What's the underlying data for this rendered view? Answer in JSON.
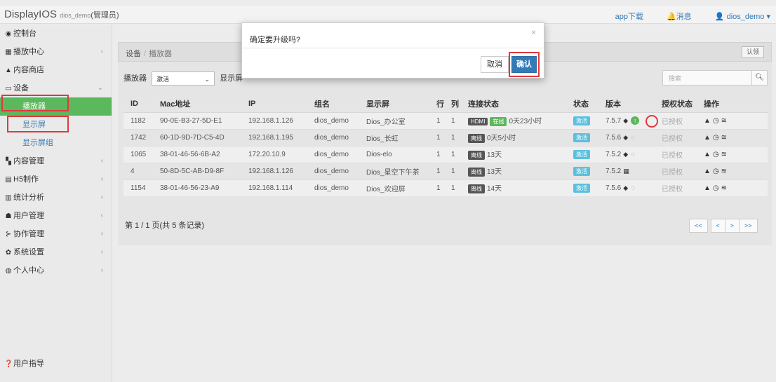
{
  "header": {
    "brand": "DisplayIOS",
    "brand_user": "dios_demo",
    "brand_role": "(管理员)",
    "app_download": "app下载",
    "messages": "消息",
    "user": "dios_demo"
  },
  "sidebar": {
    "items": [
      {
        "label": "控制台",
        "icon": "dashboard-icon",
        "arrow": ""
      },
      {
        "label": "播放中心",
        "icon": "grid-icon",
        "arrow": "‹"
      },
      {
        "label": "内容商店",
        "icon": "store-icon",
        "arrow": ""
      },
      {
        "label": "设备",
        "icon": "monitor-icon",
        "arrow": "⌄"
      },
      {
        "label": "播放器",
        "icon": "",
        "arrow": ""
      },
      {
        "label": "显示屏",
        "icon": "",
        "arrow": ""
      },
      {
        "label": "显示屏组",
        "icon": "",
        "arrow": ""
      },
      {
        "label": "内容管理",
        "icon": "content-icon",
        "arrow": "‹"
      },
      {
        "label": "H5制作",
        "icon": "h5-icon",
        "arrow": "‹"
      },
      {
        "label": "统计分析",
        "icon": "chart-icon",
        "arrow": "‹"
      },
      {
        "label": "用户管理",
        "icon": "users-icon",
        "arrow": "‹"
      },
      {
        "label": "协作管理",
        "icon": "flow-icon",
        "arrow": "‹"
      },
      {
        "label": "系统设置",
        "icon": "gear-icon",
        "arrow": "‹"
      },
      {
        "label": "个人中心",
        "icon": "person-icon",
        "arrow": "‹"
      }
    ],
    "guide": "用户指导"
  },
  "breadcrumb": {
    "root": "设备",
    "separator": "/",
    "current": "播放器",
    "auth_button": "认领"
  },
  "filter": {
    "player_label": "播放器",
    "player_value": "激活",
    "screen_label": "显示屏"
  },
  "search": {
    "placeholder": "搜索"
  },
  "table": {
    "headers": [
      "ID",
      "Mac地址",
      "IP",
      "组名",
      "显示屏",
      "行",
      "列",
      "连接状态",
      "状态",
      "版本",
      "授权状态",
      "操作"
    ],
    "rows": [
      {
        "id": "1182",
        "mac": "90-0E-B3-27-5D-E1",
        "ip": "192.168.1.126",
        "group": "dios_demo",
        "screen": "Dios_办公室",
        "row": "1",
        "col": "1",
        "tag1": "HDMI",
        "tag2": "在线",
        "conn": "0天23小时",
        "status": "激活",
        "version": "7.5.7",
        "os": "android",
        "auth": "已授权",
        "upgrade": true
      },
      {
        "id": "1742",
        "mac": "60-1D-9D-7D-C5-4D",
        "ip": "192.168.1.195",
        "group": "dios_demo",
        "screen": "Dios_长虹",
        "row": "1",
        "col": "1",
        "tag1": "离线",
        "tag2": "",
        "conn": "0天5小时",
        "status": "激活",
        "version": "7.5.6",
        "os": "android",
        "auth": "已授权",
        "upgrade": false
      },
      {
        "id": "1065",
        "mac": "38-01-46-56-6B-A2",
        "ip": "172.20.10.9",
        "group": "dios_demo",
        "screen": "Dios-elo",
        "row": "1",
        "col": "1",
        "tag1": "离线",
        "tag2": "",
        "conn": "13天",
        "status": "激活",
        "version": "7.5.2",
        "os": "android",
        "auth": "已授权",
        "upgrade": false
      },
      {
        "id": "4",
        "mac": "50-8D-5C-AB-D9-8F",
        "ip": "192.168.1.126",
        "group": "dios_demo",
        "screen": "Dios_星空下午茶",
        "row": "1",
        "col": "1",
        "tag1": "离线",
        "tag2": "",
        "conn": "13天",
        "status": "激活",
        "version": "7.5.2",
        "os": "windows",
        "auth": "已授权",
        "upgrade": false
      },
      {
        "id": "1154",
        "mac": "38-01-46-56-23-A9",
        "ip": "192.168.1.114",
        "group": "dios_demo",
        "screen": "Dios_欢迎屏",
        "row": "1",
        "col": "1",
        "tag1": "离线",
        "tag2": "",
        "conn": "14天",
        "status": "激活",
        "version": "7.5.6",
        "os": "android",
        "auth": "已授权",
        "upgrade": false
      }
    ]
  },
  "pagination": {
    "summary": "第 1 / 1 页(共 5 条记录)",
    "first": "<<",
    "prev": "<",
    "next": ">",
    "last": ">>"
  },
  "modal": {
    "title": "确定要升级吗?",
    "close": "×",
    "cancel": "取消",
    "confirm": "确认"
  },
  "colors": {
    "accent": "#337ab7",
    "active": "#5cb85c",
    "highlight": "#e0393e"
  }
}
